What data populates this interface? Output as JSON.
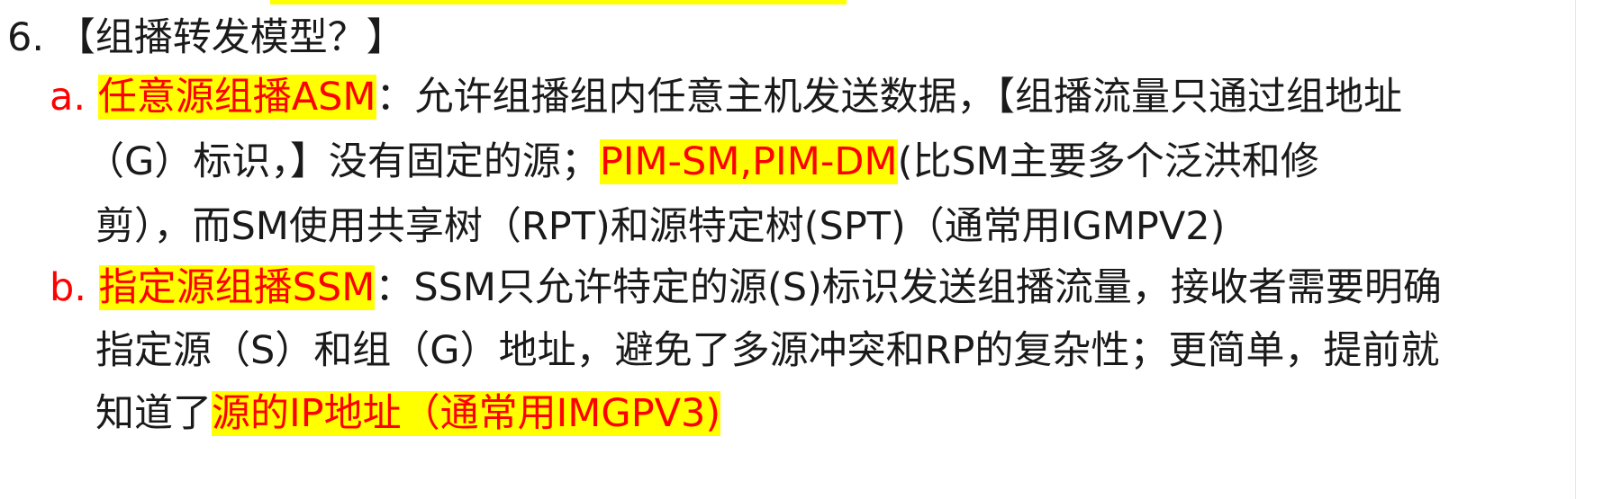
{
  "heading": {
    "number": "6.",
    "text": "【组播转发模型？】"
  },
  "items": [
    {
      "marker": "a.",
      "term": "任意源组播ASM",
      "line1_rest": "：允许组播组内任意主机发送数据，【组播流量只通过组地址",
      "line2_before": "（G）标识，】没有固定的源；",
      "line2_highlight": "PIM-SM,PIM-DM",
      "line2_after": "(比SM主要多个泛洪和修",
      "line3": "剪），而SM使用共享树（RPT)和源特定树(SPT)（通常用IGMPV2)"
    },
    {
      "marker": "b.",
      "term": "指定源组播SSM",
      "line1_rest": "：SSM只允许特定的源(S)标识发送组播流量，接收者需要明确",
      "line2": "指定源（S）和组（G）地址，避免了多源冲突和RP的复杂性；更简单，提前就",
      "line3_before": "知道了",
      "line3_highlight": "源的IP地址（通常用IMGPV3)"
    }
  ],
  "colors": {
    "highlight": "#ffff00",
    "emphasis_text": "#ff0000",
    "body_text": "#1a1a1a"
  }
}
